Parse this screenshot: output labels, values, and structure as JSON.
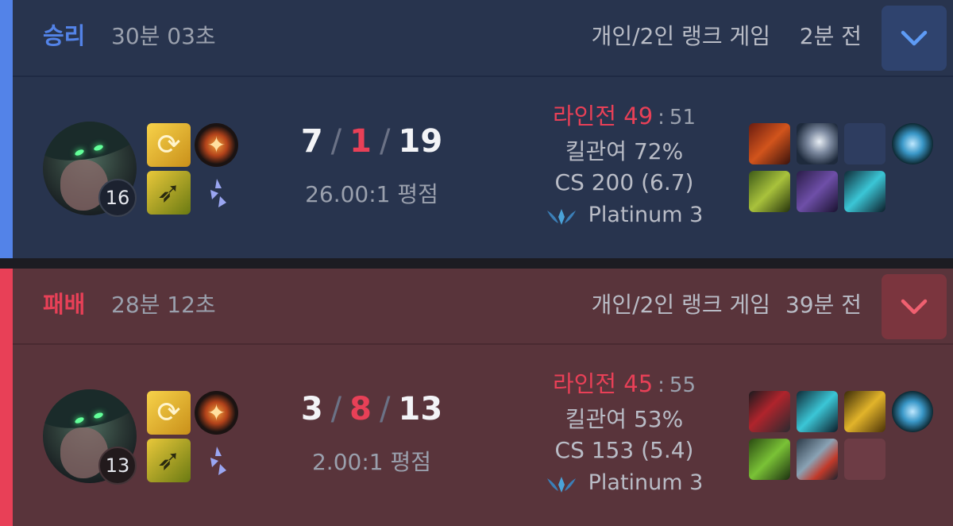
{
  "matches": [
    {
      "result": "승리",
      "duration": "30분 03초",
      "queue": "개인/2인 랭크 게임",
      "time_ago": "2분 전",
      "expand_icon": "chevron-down-icon",
      "level": "16",
      "kills": "7",
      "deaths": "1",
      "assists": "19",
      "kda_ratio": "26.00:1 평점",
      "lane_label": "라인전",
      "lane_score": "49",
      "lane_opponent": "51",
      "kill_participation": "킬관여 72%",
      "cs": "CS 200 (6.7)",
      "tier": "Platinum 3"
    },
    {
      "result": "패배",
      "duration": "28분 12초",
      "queue": "개인/2인 랭크 게임",
      "time_ago": "39분 전",
      "expand_icon": "chevron-down-icon",
      "level": "13",
      "kills": "3",
      "deaths": "8",
      "assists": "13",
      "kda_ratio": "2.00:1 평점",
      "lane_label": "라인전",
      "lane_score": "45",
      "lane_opponent": "55",
      "kill_participation": "킬관여 53%",
      "cs": "CS 153 (5.4)",
      "tier": "Platinum 3"
    }
  ],
  "colors": {
    "win": "#5383e8",
    "loss": "#e84057",
    "win_bg": "#28344e",
    "loss_bg": "#59343b"
  }
}
